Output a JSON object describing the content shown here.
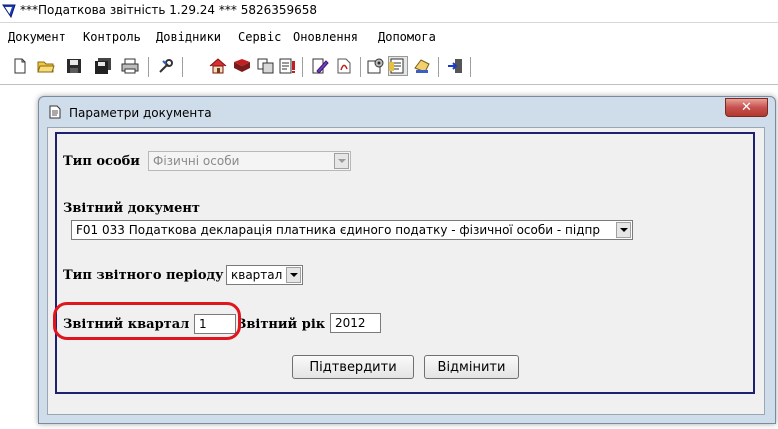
{
  "window": {
    "title": "***Податкова звітність 1.29.24 *** 5826359658"
  },
  "menu": {
    "items": [
      "Документ",
      "Контроль",
      "Довідники",
      "Сервіс",
      "Оновлення",
      "Допомога"
    ]
  },
  "toolbar": {
    "icons": [
      "new-document-icon",
      "open-folder-icon",
      "save-icon",
      "save-all-icon",
      "print-icon",
      "tools-icon",
      "home-icon",
      "book-icon",
      "copy-icon",
      "report-icon",
      "pen-icon",
      "pdf-icon",
      "settings-icon",
      "document-check-icon",
      "hand-icon",
      "exit-icon"
    ]
  },
  "dialog": {
    "title": "Параметри документа",
    "close_symbol": "✕",
    "person_type_label": "Тип особи",
    "person_type_value": "Фізичні особи",
    "report_doc_label": "Звітний документ",
    "report_doc_value": "F01 033 Податкова декларація платника єдиного податку - фізичної особи - підпр",
    "period_type_label": "Тип звітного періоду",
    "period_type_value": "квартал",
    "quarter_label": "Звітний квартал",
    "quarter_value": "1",
    "year_label": "Звітний рік",
    "year_value": "2012",
    "confirm_label": "Підтвердити",
    "cancel_label": "Відмінити"
  },
  "colors": {
    "highlight": "#e0161e",
    "panel_border": "#1e2070",
    "dialog_frame": "#cfdcea",
    "close_button": "#c75050"
  }
}
